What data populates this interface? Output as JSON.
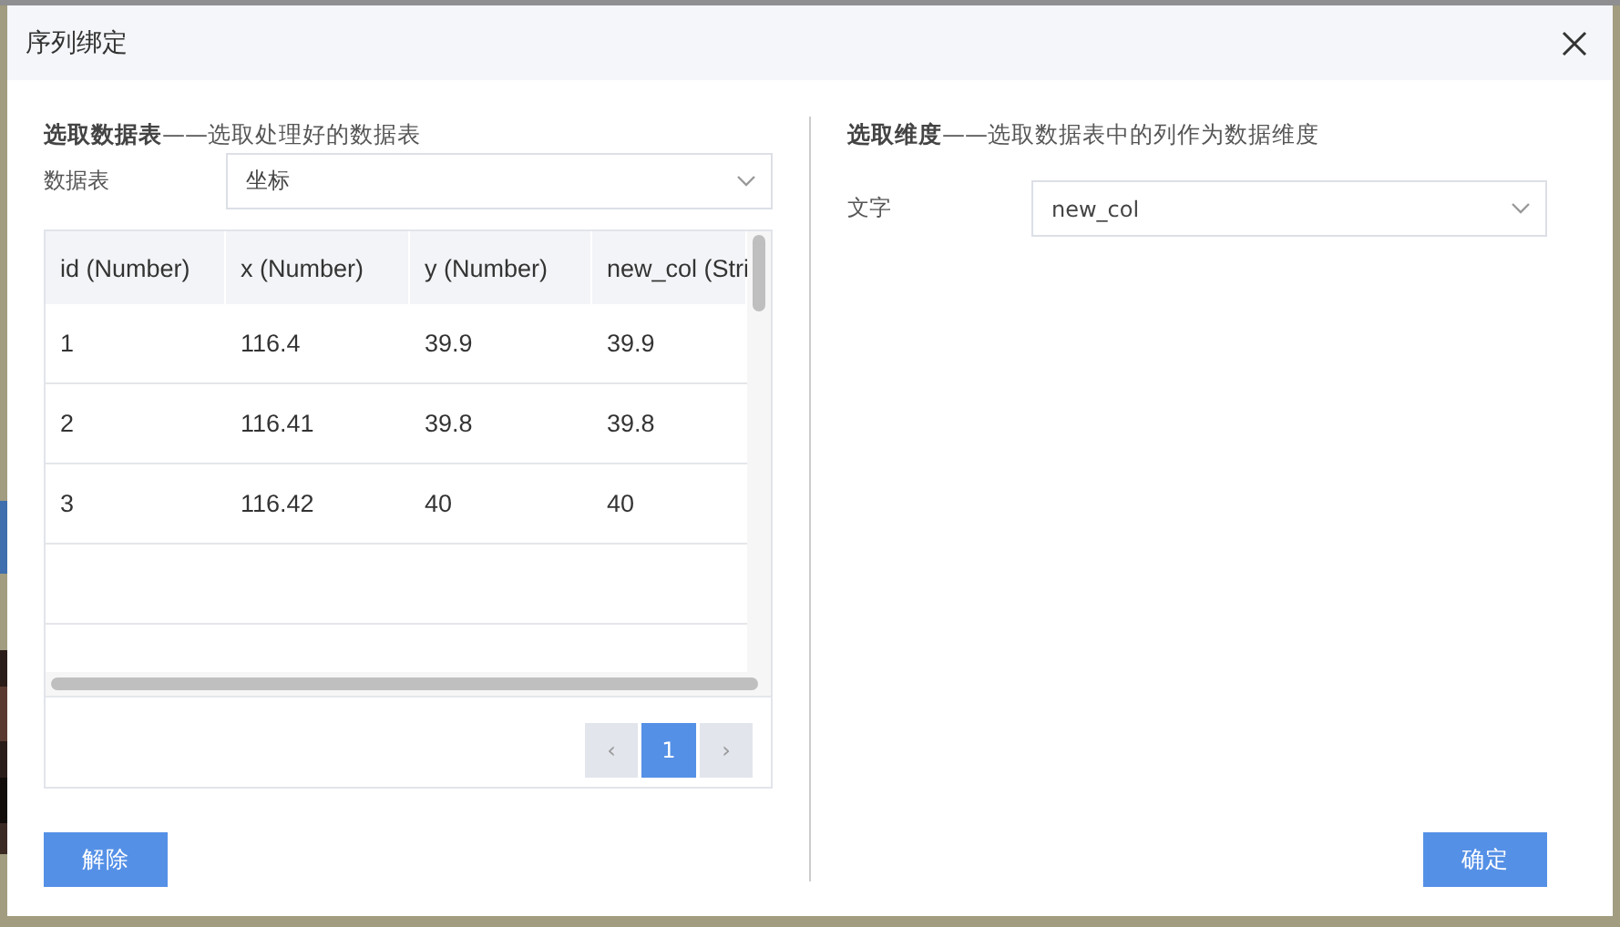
{
  "dialog": {
    "title": "序列绑定"
  },
  "left": {
    "heading_bold": "选取数据表",
    "heading_rest": "——选取处理好的数据表",
    "field_label": "数据表",
    "select_value": "坐标",
    "table": {
      "columns": [
        "id (Number)",
        "x (Number)",
        "y (Number)",
        "new_col (Stri"
      ],
      "rows": [
        [
          "1",
          "116.4",
          "39.9",
          "39.9"
        ],
        [
          "2",
          "116.41",
          "39.8",
          "39.8"
        ],
        [
          "3",
          "116.42",
          "40",
          "40"
        ]
      ]
    },
    "pagination": {
      "prev": "‹",
      "next": "›",
      "pages": [
        {
          "label": "1",
          "selected": true
        }
      ]
    },
    "button": "解除"
  },
  "right": {
    "heading_bold": "选取维度",
    "heading_rest": "——选取数据表中的列作为数据维度",
    "field_label": "文字",
    "select_value": "new_col",
    "button": "确定"
  }
}
